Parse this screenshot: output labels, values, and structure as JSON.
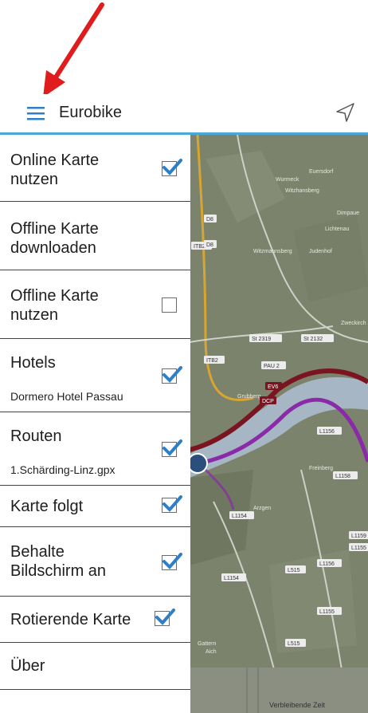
{
  "app_title": "Eurobike",
  "menu": [
    {
      "label": "Online Karte\nnutzen",
      "checked": true
    },
    {
      "label": "Offline Karte\ndownloaden"
    },
    {
      "label": "Offline Karte\nnutzen",
      "checked": false
    },
    {
      "label": "Hotels",
      "sub": "Dormero Hotel Passau",
      "checked": true
    },
    {
      "label": "Routen",
      "sub": "1.Schärding-Linz.gpx",
      "checked": true
    },
    {
      "label": "Karte folgt",
      "checked": true
    },
    {
      "label": "Behalte\nBildschirm an",
      "checked": true
    },
    {
      "label": "Rotierende Karte",
      "checked": true
    },
    {
      "label": "Über"
    }
  ],
  "map": {
    "places": [
      "Euersdorf",
      "Wurmeck",
      "Witzhansberg",
      "Dimpaue",
      "Lichtenau",
      "Witzmannsberg",
      "Judenhof",
      "Zweckirch",
      "Grubberg",
      "Freinberg",
      "Arzgen",
      "Gattern",
      "Aich"
    ],
    "roads": [
      "D8",
      "ITB2",
      "D8",
      "St 2319",
      "St 2132",
      "ITB2",
      "PAU 2",
      "EV6",
      "DCP",
      "L1156",
      "L1158",
      "L1159",
      "L1154",
      "L1155",
      "L1156",
      "L515",
      "L1154",
      "L1155",
      "L515"
    ],
    "bottom_text": "Verbleibende Zeit",
    "colors": {
      "route_dark": "#7a1420",
      "route_purple": "#8a2aa8",
      "route_orange": "#d8a630",
      "river": "#a7b6c4"
    }
  },
  "colors": {
    "accent": "#2f7fc6",
    "divider": "#4aa8d8",
    "arrow": "#e01c1c"
  }
}
